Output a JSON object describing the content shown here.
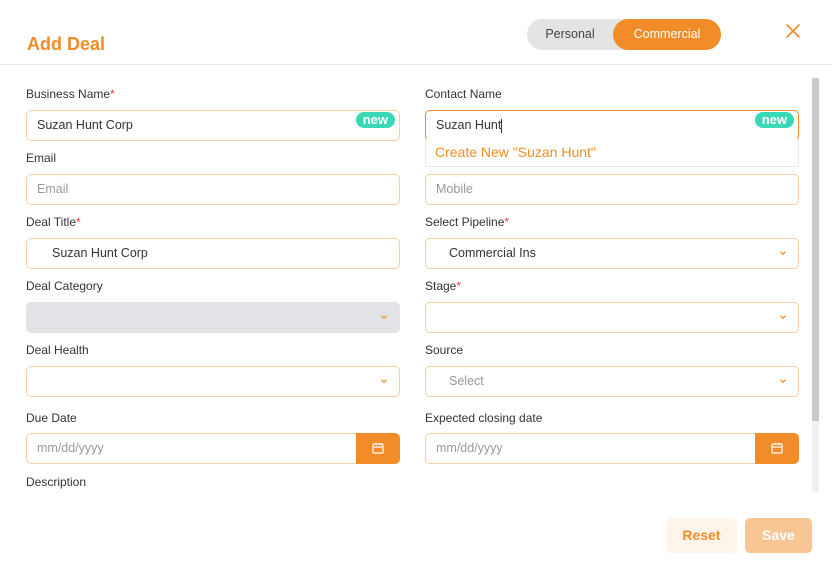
{
  "modal": {
    "title": "Add Deal",
    "toggle": {
      "personal_label": "Personal",
      "commercial_label": "Commercial",
      "selected": "Commercial"
    }
  },
  "form": {
    "business_name": {
      "label": "Business Name",
      "required_mark": "*",
      "value": "Suzan Hunt Corp",
      "badge": "new"
    },
    "contact_name": {
      "label": "Contact Name",
      "value": "Suzan Hunt",
      "badge": "new",
      "suggestion": "Create New \"Suzan Hunt\""
    },
    "email": {
      "label": "Email",
      "placeholder": "Email"
    },
    "mobile": {
      "placeholder": "Mobile"
    },
    "deal_title": {
      "label": "Deal Title",
      "required_mark": "*",
      "value": "Suzan Hunt Corp"
    },
    "select_pipeline": {
      "label": "Select Pipeline",
      "required_mark": "*",
      "value": "Commercial Ins"
    },
    "deal_category": {
      "label": "Deal Category",
      "value": ""
    },
    "stage": {
      "label": "Stage",
      "required_mark": "*",
      "value": ""
    },
    "deal_health": {
      "label": "Deal Health",
      "value": ""
    },
    "source": {
      "label": "Source",
      "placeholder": "Select"
    },
    "due_date": {
      "label": "Due Date",
      "placeholder": "mm/dd/yyyy"
    },
    "expected_closing_date": {
      "label": "Expected closing date",
      "placeholder": "mm/dd/yyyy"
    },
    "description": {
      "label": "Description"
    }
  },
  "actions": {
    "reset_label": "Reset",
    "save_label": "Save"
  },
  "colors": {
    "accent": "#f28c28",
    "badge": "#3ad8b6",
    "required": "#e53935",
    "disabled_bg": "#e1e3e6"
  },
  "icons": {
    "close": "close-icon",
    "chevron": "chevron-down-icon",
    "calendar": "calendar-icon"
  }
}
